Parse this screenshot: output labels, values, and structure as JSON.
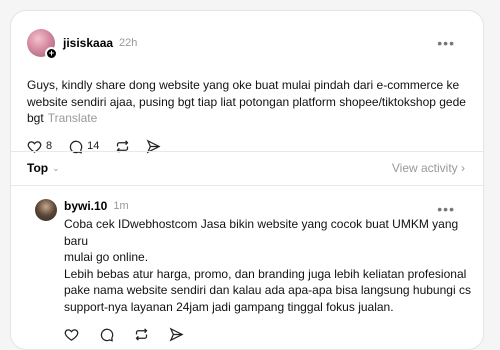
{
  "post": {
    "username": "jisiskaaa",
    "time": "22h",
    "text_line1": "Guys, kindly share dong website yang oke buat mulai pindah dari e-commerce ke",
    "text_line2": "website sendiri ajaa, pusing bgt tiap liat potongan platform shopee/tiktokshop gede",
    "text_line3": "bgt",
    "translate": "Translate",
    "likes": "8",
    "comments": "14"
  },
  "sort": {
    "label": "Top",
    "chevron": "⌄"
  },
  "view_activity": "View activity ›",
  "reply": {
    "username": "bywi.10",
    "time": "1m",
    "line1": "Coba cek IDwebhostcom Jasa bikin website yang cocok buat UMKM yang baru",
    "line2": "mulai go online.",
    "line3": "Lebih bebas atur harga, promo, dan branding juga lebih keliatan profesional",
    "line4": "pake nama website sendiri dan kalau ada apa-apa bisa langsung hubungi cs",
    "line5": "support-nya layanan 24jam jadi gampang tinggal fokus jualan."
  },
  "more_glyph": "•••",
  "icons": [
    "heart-icon",
    "comment-icon",
    "repost-icon",
    "share-icon",
    "more-icon"
  ]
}
